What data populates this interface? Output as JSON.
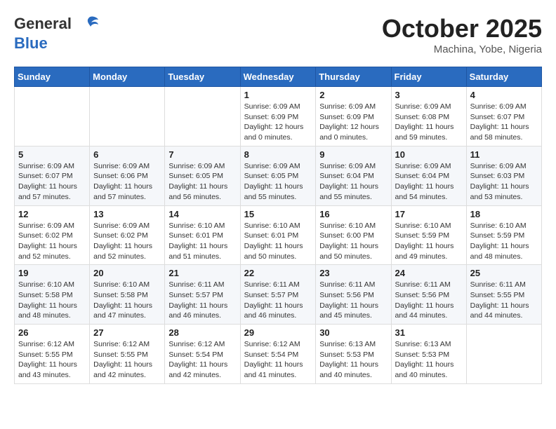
{
  "header": {
    "logo_line1": "General",
    "logo_line2": "Blue",
    "month": "October 2025",
    "location": "Machina, Yobe, Nigeria"
  },
  "weekdays": [
    "Sunday",
    "Monday",
    "Tuesday",
    "Wednesday",
    "Thursday",
    "Friday",
    "Saturday"
  ],
  "weeks": [
    [
      {
        "day": "",
        "sunrise": "",
        "sunset": "",
        "daylight": ""
      },
      {
        "day": "",
        "sunrise": "",
        "sunset": "",
        "daylight": ""
      },
      {
        "day": "",
        "sunrise": "",
        "sunset": "",
        "daylight": ""
      },
      {
        "day": "1",
        "sunrise": "Sunrise: 6:09 AM",
        "sunset": "Sunset: 6:09 PM",
        "daylight": "Daylight: 12 hours and 0 minutes."
      },
      {
        "day": "2",
        "sunrise": "Sunrise: 6:09 AM",
        "sunset": "Sunset: 6:09 PM",
        "daylight": "Daylight: 12 hours and 0 minutes."
      },
      {
        "day": "3",
        "sunrise": "Sunrise: 6:09 AM",
        "sunset": "Sunset: 6:08 PM",
        "daylight": "Daylight: 11 hours and 59 minutes."
      },
      {
        "day": "4",
        "sunrise": "Sunrise: 6:09 AM",
        "sunset": "Sunset: 6:07 PM",
        "daylight": "Daylight: 11 hours and 58 minutes."
      }
    ],
    [
      {
        "day": "5",
        "sunrise": "Sunrise: 6:09 AM",
        "sunset": "Sunset: 6:07 PM",
        "daylight": "Daylight: 11 hours and 57 minutes."
      },
      {
        "day": "6",
        "sunrise": "Sunrise: 6:09 AM",
        "sunset": "Sunset: 6:06 PM",
        "daylight": "Daylight: 11 hours and 57 minutes."
      },
      {
        "day": "7",
        "sunrise": "Sunrise: 6:09 AM",
        "sunset": "Sunset: 6:05 PM",
        "daylight": "Daylight: 11 hours and 56 minutes."
      },
      {
        "day": "8",
        "sunrise": "Sunrise: 6:09 AM",
        "sunset": "Sunset: 6:05 PM",
        "daylight": "Daylight: 11 hours and 55 minutes."
      },
      {
        "day": "9",
        "sunrise": "Sunrise: 6:09 AM",
        "sunset": "Sunset: 6:04 PM",
        "daylight": "Daylight: 11 hours and 55 minutes."
      },
      {
        "day": "10",
        "sunrise": "Sunrise: 6:09 AM",
        "sunset": "Sunset: 6:04 PM",
        "daylight": "Daylight: 11 hours and 54 minutes."
      },
      {
        "day": "11",
        "sunrise": "Sunrise: 6:09 AM",
        "sunset": "Sunset: 6:03 PM",
        "daylight": "Daylight: 11 hours and 53 minutes."
      }
    ],
    [
      {
        "day": "12",
        "sunrise": "Sunrise: 6:09 AM",
        "sunset": "Sunset: 6:02 PM",
        "daylight": "Daylight: 11 hours and 52 minutes."
      },
      {
        "day": "13",
        "sunrise": "Sunrise: 6:09 AM",
        "sunset": "Sunset: 6:02 PM",
        "daylight": "Daylight: 11 hours and 52 minutes."
      },
      {
        "day": "14",
        "sunrise": "Sunrise: 6:10 AM",
        "sunset": "Sunset: 6:01 PM",
        "daylight": "Daylight: 11 hours and 51 minutes."
      },
      {
        "day": "15",
        "sunrise": "Sunrise: 6:10 AM",
        "sunset": "Sunset: 6:01 PM",
        "daylight": "Daylight: 11 hours and 50 minutes."
      },
      {
        "day": "16",
        "sunrise": "Sunrise: 6:10 AM",
        "sunset": "Sunset: 6:00 PM",
        "daylight": "Daylight: 11 hours and 50 minutes."
      },
      {
        "day": "17",
        "sunrise": "Sunrise: 6:10 AM",
        "sunset": "Sunset: 5:59 PM",
        "daylight": "Daylight: 11 hours and 49 minutes."
      },
      {
        "day": "18",
        "sunrise": "Sunrise: 6:10 AM",
        "sunset": "Sunset: 5:59 PM",
        "daylight": "Daylight: 11 hours and 48 minutes."
      }
    ],
    [
      {
        "day": "19",
        "sunrise": "Sunrise: 6:10 AM",
        "sunset": "Sunset: 5:58 PM",
        "daylight": "Daylight: 11 hours and 48 minutes."
      },
      {
        "day": "20",
        "sunrise": "Sunrise: 6:10 AM",
        "sunset": "Sunset: 5:58 PM",
        "daylight": "Daylight: 11 hours and 47 minutes."
      },
      {
        "day": "21",
        "sunrise": "Sunrise: 6:11 AM",
        "sunset": "Sunset: 5:57 PM",
        "daylight": "Daylight: 11 hours and 46 minutes."
      },
      {
        "day": "22",
        "sunrise": "Sunrise: 6:11 AM",
        "sunset": "Sunset: 5:57 PM",
        "daylight": "Daylight: 11 hours and 46 minutes."
      },
      {
        "day": "23",
        "sunrise": "Sunrise: 6:11 AM",
        "sunset": "Sunset: 5:56 PM",
        "daylight": "Daylight: 11 hours and 45 minutes."
      },
      {
        "day": "24",
        "sunrise": "Sunrise: 6:11 AM",
        "sunset": "Sunset: 5:56 PM",
        "daylight": "Daylight: 11 hours and 44 minutes."
      },
      {
        "day": "25",
        "sunrise": "Sunrise: 6:11 AM",
        "sunset": "Sunset: 5:55 PM",
        "daylight": "Daylight: 11 hours and 44 minutes."
      }
    ],
    [
      {
        "day": "26",
        "sunrise": "Sunrise: 6:12 AM",
        "sunset": "Sunset: 5:55 PM",
        "daylight": "Daylight: 11 hours and 43 minutes."
      },
      {
        "day": "27",
        "sunrise": "Sunrise: 6:12 AM",
        "sunset": "Sunset: 5:55 PM",
        "daylight": "Daylight: 11 hours and 42 minutes."
      },
      {
        "day": "28",
        "sunrise": "Sunrise: 6:12 AM",
        "sunset": "Sunset: 5:54 PM",
        "daylight": "Daylight: 11 hours and 42 minutes."
      },
      {
        "day": "29",
        "sunrise": "Sunrise: 6:12 AM",
        "sunset": "Sunset: 5:54 PM",
        "daylight": "Daylight: 11 hours and 41 minutes."
      },
      {
        "day": "30",
        "sunrise": "Sunrise: 6:13 AM",
        "sunset": "Sunset: 5:53 PM",
        "daylight": "Daylight: 11 hours and 40 minutes."
      },
      {
        "day": "31",
        "sunrise": "Sunrise: 6:13 AM",
        "sunset": "Sunset: 5:53 PM",
        "daylight": "Daylight: 11 hours and 40 minutes."
      },
      {
        "day": "",
        "sunrise": "",
        "sunset": "",
        "daylight": ""
      }
    ]
  ]
}
